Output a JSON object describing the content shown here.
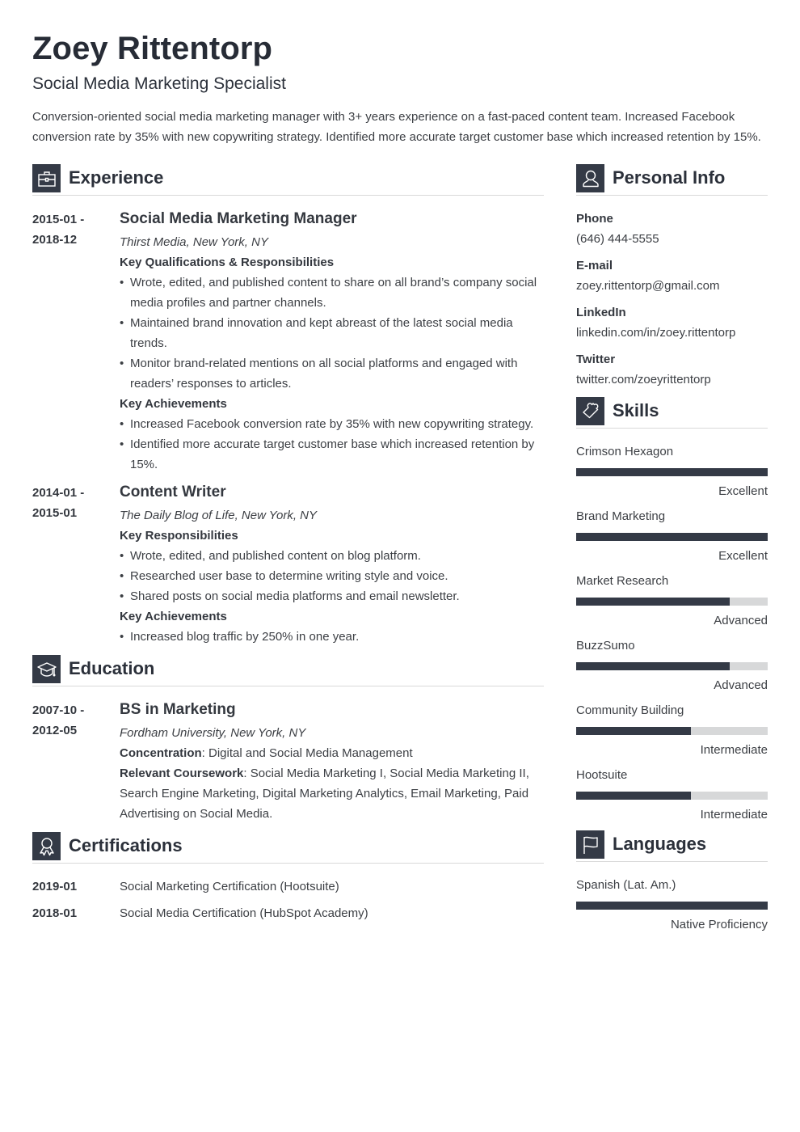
{
  "header": {
    "name": "Zoey Rittentorp",
    "title": "Social Media Marketing Specialist",
    "summary": "Conversion-oriented social media marketing manager with 3+ years experience on a fast-paced content team. Increased Facebook conversion rate by 35% with new copywriting strategy. Identified more accurate target customer base which increased retention by 15%."
  },
  "theme": {
    "accent": "#343a46",
    "track": "#d7d8d9",
    "text": "#3c3f44"
  },
  "experience": {
    "heading": "Experience",
    "icon": "briefcase-icon",
    "jobs": [
      {
        "date_start": "2015-01 -",
        "date_end": "2018-12",
        "role": "Social Media Marketing Manager",
        "org": "Thirst Media, New York, NY",
        "groups": [
          {
            "label": "Key Qualifications & Responsibilities",
            "items": [
              "Wrote, edited, and published content to share on all brand’s company social media profiles and partner channels.",
              "Maintained brand innovation and kept abreast of the latest social media trends.",
              "Monitor brand-related mentions on all social platforms and engaged with readers’ responses to articles."
            ]
          },
          {
            "label": "Key Achievements",
            "items": [
              "Increased Facebook conversion rate by 35% with new copywriting strategy.",
              "Identified more accurate target customer base which increased retention by 15%."
            ]
          }
        ]
      },
      {
        "date_start": "2014-01 -",
        "date_end": "2015-01",
        "role": "Content Writer",
        "org": "The Daily Blog of Life, New York, NY",
        "groups": [
          {
            "label": "Key Responsibilities",
            "items": [
              "Wrote, edited, and published content on blog platform.",
              "Researched user base to determine writing style and voice.",
              "Shared posts on social media platforms and email newsletter."
            ]
          },
          {
            "label": "Key Achievements",
            "items": [
              "Increased blog traffic by 250% in one year."
            ]
          }
        ]
      }
    ]
  },
  "education": {
    "heading": "Education",
    "icon": "graduation-cap-icon",
    "entries": [
      {
        "date_start": "2007-10 -",
        "date_end": "2012-05",
        "degree": "BS in Marketing",
        "school": "Fordham University, New York, NY",
        "concentration_label": "Concentration",
        "concentration": ": Digital and Social Media Management",
        "coursework_label": "Relevant Coursework",
        "coursework": ": Social Media Marketing I, Social Media Marketing II, Search Engine Marketing, Digital Marketing Analytics, Email Marketing, Paid Advertising on Social Media."
      }
    ]
  },
  "certifications": {
    "heading": "Certifications",
    "icon": "award-ribbon-icon",
    "items": [
      {
        "date": "2019-01",
        "name": "Social Marketing Certification (Hootsuite)"
      },
      {
        "date": "2018-01",
        "name": "Social Media Certification (HubSpot Academy)"
      }
    ]
  },
  "personal_info": {
    "heading": "Personal Info",
    "icon": "user-icon",
    "fields": [
      {
        "label": "Phone",
        "value": "(646) 444-5555"
      },
      {
        "label": "E-mail",
        "value": "zoey.rittentorp@gmail.com"
      },
      {
        "label": "LinkedIn",
        "value": "linkedin.com/in/zoey.rittentorp"
      },
      {
        "label": "Twitter",
        "value": "twitter.com/zoeyrittentorp"
      }
    ]
  },
  "skills": {
    "heading": "Skills",
    "icon": "puzzle-piece-icon",
    "items": [
      {
        "name": "Crimson Hexagon",
        "level": "Excellent",
        "fraction": 1.0
      },
      {
        "name": "Brand Marketing",
        "level": "Excellent",
        "fraction": 1.0
      },
      {
        "name": "Market Research",
        "level": "Advanced",
        "fraction": 0.8
      },
      {
        "name": "BuzzSumo",
        "level": "Advanced",
        "fraction": 0.8
      },
      {
        "name": "Community Building",
        "level": "Intermediate",
        "fraction": 0.6
      },
      {
        "name": "Hootsuite",
        "level": "Intermediate",
        "fraction": 0.6
      }
    ]
  },
  "languages": {
    "heading": "Languages",
    "icon": "flag-icon",
    "items": [
      {
        "name": "Spanish (Lat. Am.)",
        "level": "Native Proficiency",
        "fraction": 1.0
      }
    ]
  }
}
